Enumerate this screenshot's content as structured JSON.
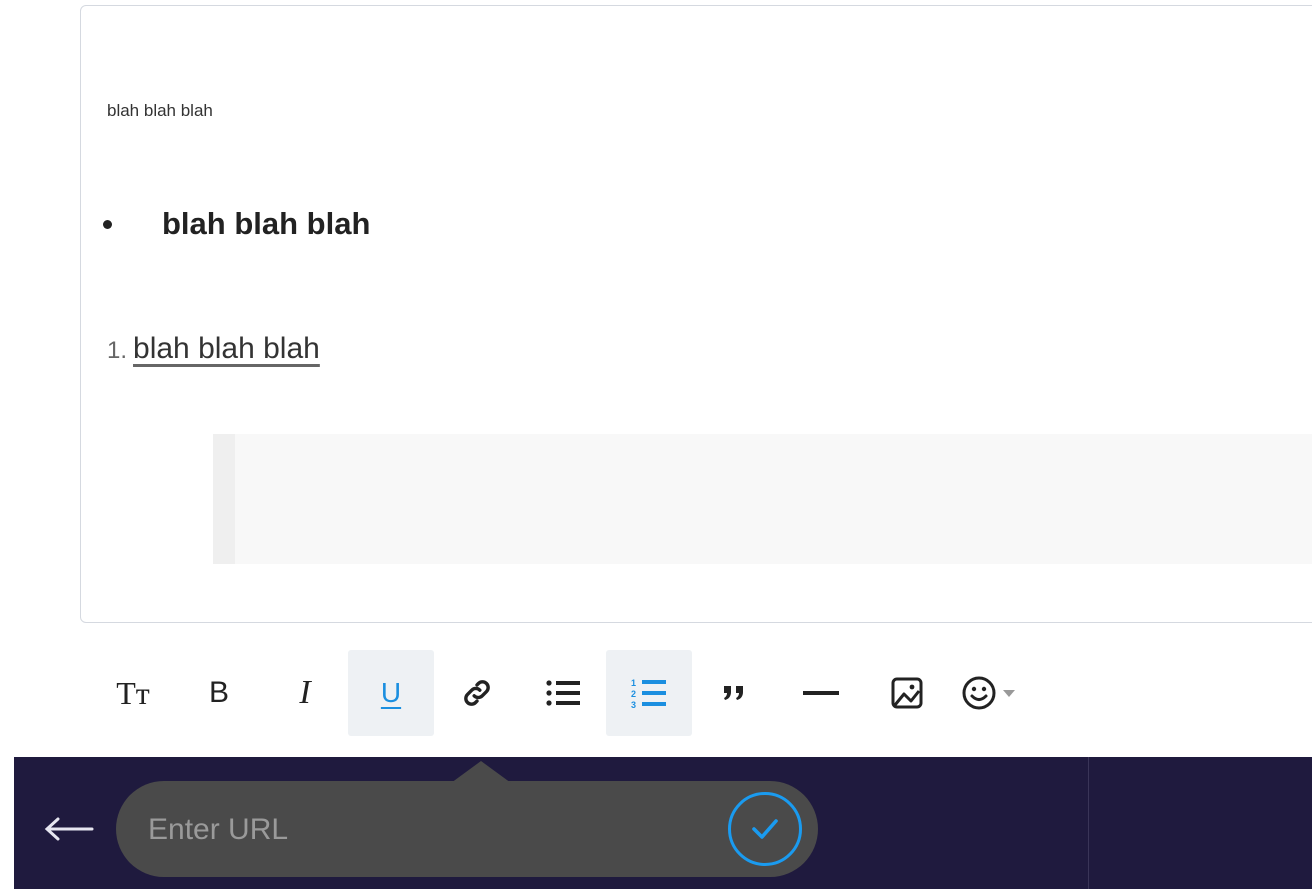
{
  "editor": {
    "paragraph_text": "blah blah blah",
    "bullet_text": "blah blah blah",
    "numbered_marker": "1.",
    "numbered_text": "blah blah blah"
  },
  "toolbar": {
    "items": [
      {
        "name": "text-size",
        "icon": "text-size-icon",
        "active": false
      },
      {
        "name": "bold",
        "icon": "bold-icon",
        "active": false
      },
      {
        "name": "italic",
        "icon": "italic-icon",
        "active": false
      },
      {
        "name": "underline",
        "icon": "underline-icon",
        "active": true
      },
      {
        "name": "link",
        "icon": "link-icon",
        "active": false
      },
      {
        "name": "bullet-list",
        "icon": "bullet-list-icon",
        "active": false
      },
      {
        "name": "numbered-list",
        "icon": "numbered-list-icon",
        "active": true
      },
      {
        "name": "quote",
        "icon": "quote-icon",
        "active": false
      },
      {
        "name": "horizontal-rule",
        "icon": "horizontal-rule-icon",
        "active": false
      },
      {
        "name": "image",
        "icon": "image-icon",
        "active": false
      },
      {
        "name": "emoji",
        "icon": "emoji-icon",
        "active": false
      }
    ],
    "text_size_label": "Tт",
    "bold_label": "B",
    "italic_label": "I",
    "underline_label": "U",
    "quote_label": "”"
  },
  "url_popup": {
    "placeholder": "Enter URL",
    "value": ""
  },
  "colors": {
    "accent": "#1b8fe0",
    "bottom_bar": "#1f1a3e",
    "url_pill": "#4a4a4a"
  }
}
